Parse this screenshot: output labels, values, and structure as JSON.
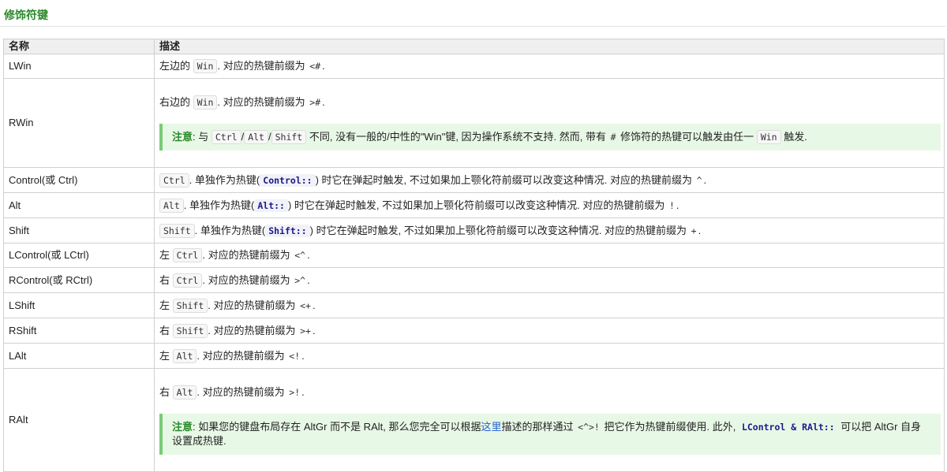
{
  "section_title": "修饰符键",
  "headers": {
    "name": "名称",
    "desc": "描述"
  },
  "rows": {
    "lwin": {
      "name": "LWin",
      "pre": "左边的",
      "code": "Win",
      "post": ". 对应的热键前缀为",
      "prefix": "<#",
      "end": "."
    },
    "rwin": {
      "name": "RWin",
      "pre": "右边的",
      "code": "Win",
      "post": ". 对应的热键前缀为",
      "prefix": ">#",
      "end": ".",
      "note": {
        "label": "注意",
        "t1": ": 与",
        "k1": "Ctrl",
        "s1": "/",
        "k2": "Alt",
        "s2": "/",
        "k3": "Shift",
        "t2": "不同, 没有一般的/中性的\"Win\"键, 因为操作系统不支持. 然而, 带有",
        "hash": "#",
        "t3": "修饰符的热键可以触发由任一",
        "k4": "Win",
        "t4": "触发."
      }
    },
    "control": {
      "name": "Control(或 Ctrl)",
      "code": "Ctrl",
      "t1": ". 单独作为热键(",
      "kw": "Control::",
      "t2": ") 时它在弹起时触发, 不过如果加上颚化符前缀可以改变这种情况. 对应的热键前缀为",
      "prefix": "^",
      "end": "."
    },
    "alt": {
      "name": "Alt",
      "code": "Alt",
      "t1": ". 单独作为热键(",
      "kw": "Alt::",
      "t2": ") 时它在弹起时触发, 不过如果加上颚化符前缀可以改变这种情况. 对应的热键前缀为",
      "prefix": "!",
      "end": "."
    },
    "shift": {
      "name": "Shift",
      "code": "Shift",
      "t1": ". 单独作为热键(",
      "kw": "Shift::",
      "t2": ") 时它在弹起时触发, 不过如果加上颚化符前缀可以改变这种情况. 对应的热键前缀为",
      "prefix": "+",
      "end": "."
    },
    "lcontrol": {
      "name": "LControl(或 LCtrl)",
      "pre": "左",
      "code": "Ctrl",
      "post": ". 对应的热键前缀为",
      "prefix": "<^",
      "end": "."
    },
    "rcontrol": {
      "name": "RControl(或 RCtrl)",
      "pre": "右",
      "code": "Ctrl",
      "post": ". 对应的热键前缀为",
      "prefix": ">^",
      "end": "."
    },
    "lshift": {
      "name": "LShift",
      "pre": "左",
      "code": "Shift",
      "post": ". 对应的热键前缀为",
      "prefix": "<+",
      "end": "."
    },
    "rshift": {
      "name": "RShift",
      "pre": "右",
      "code": "Shift",
      "post": ". 对应的热键前缀为",
      "prefix": ">+",
      "end": "."
    },
    "lalt": {
      "name": "LAlt",
      "pre": "左",
      "code": "Alt",
      "post": ". 对应的热键前缀为",
      "prefix": "<!",
      "end": "."
    },
    "ralt": {
      "name": "RAlt",
      "pre": "右",
      "code": "Alt",
      "post": ". 对应的热键前缀为",
      "prefix": ">!",
      "end": ".",
      "note": {
        "label": "注意",
        "t1": ": 如果您的键盘布局存在 AltGr 而不是 RAlt, 那么您完全可以根据",
        "link": "这里",
        "t2": "描述的那样通过",
        "code": "<^>!",
        "t3": "把它作为热键前缀使用. 此外,",
        "kw": "LControl & RAlt::",
        "t4": "可以把 AltGr 自身设置成热键."
      }
    }
  }
}
